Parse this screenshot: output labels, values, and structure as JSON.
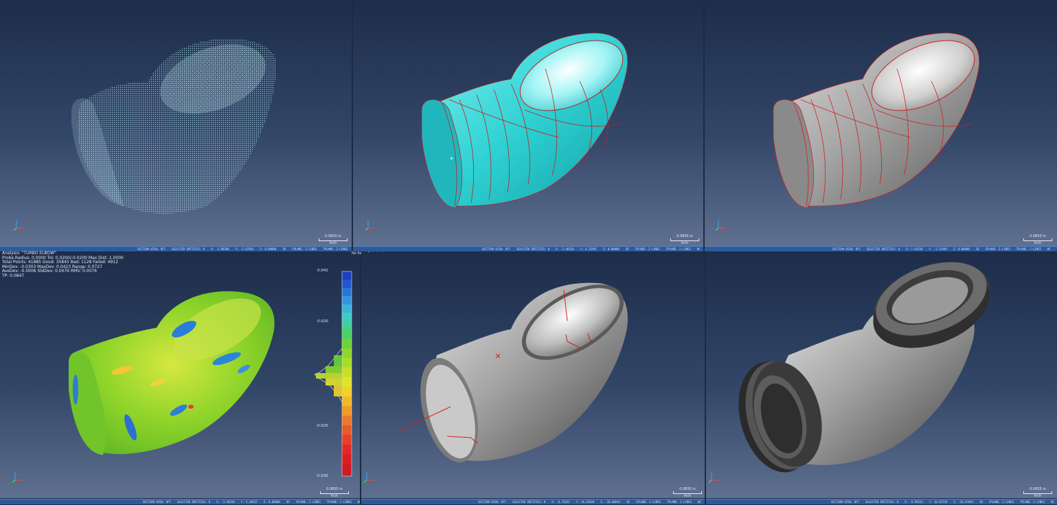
{
  "panels": {
    "p1": {
      "status": [
        "SECTION VIEW: OFF",
        "SELECTED ENTITIES: 0",
        "X: -3.96308",
        "Y: -3.42584",
        "Z: 0.80000",
        "3D",
        "CPLANE: 2-LINES",
        "TPLANE: 2-LINES",
        "WC"
      ],
      "scale": "0.0835 in",
      "unit": "Inch"
    },
    "p2": {
      "status": [
        "SECTION VIEW: OFF",
        "SELECTED ENTITIES: 0",
        "X: -3.48250",
        "Y: 4.23445",
        "Z: 0.80000",
        "3D",
        "CPLANE: 2-LINES",
        "TPLANE: 2-LINES",
        "WC"
      ],
      "scale": "0.0835 in",
      "unit": "Inch"
    },
    "p3": {
      "status": [
        "SECTION VIEW: OFF",
        "SELECTED ENTITIES: 0",
        "X: 7.44236",
        "Y: -1.12449",
        "Z: 0.00000",
        "3D",
        "CPLANE: 2-LINES",
        "TPLANE: 2-LINES",
        "WC"
      ],
      "scale": "0.0835 in",
      "unit": "Inch"
    },
    "p4": {
      "status": [
        "SECTION VIEW: OFF",
        "SELECTED ENTITIES: 0",
        "X: -3.50258",
        "Y: 5.39615",
        "Z: 0.00000",
        "3D",
        "CPLANE: 2-LINES",
        "TPLANE: 2-LINES",
        "WC"
      ],
      "scale": "0.0835 in",
      "unit": "Inch"
    },
    "p5": {
      "status": [
        "SECTION VIEW: OFF",
        "SELECTED ENTITIES: 0",
        "X: -6.75632",
        "Y: 14.26260",
        "Z: -26.60644",
        "3D",
        "CPLANE: 2-LINES",
        "TPLANE: 2-LINES",
        "WC"
      ],
      "scale": "0.0835 in",
      "unit": "Inch"
    },
    "p6": {
      "status": [
        "SECTION VIEW: OFF",
        "SELECTED ENTITIES: 0",
        "X: -9.95633",
        "Y: 10.65720",
        "Z: -26.67844",
        "3D",
        "CPLANE: 2-LINES",
        "TPLANE: 2-LINES",
        "WC"
      ],
      "scale": "0.0835 in",
      "unit": "Inch"
    }
  },
  "analysis": {
    "lines": [
      "Analysis: \"TURBO ELBOW\"",
      "Probe Radius: 0.0000 Tol: 0.0200/-0.0200 Max Dist: 1.0000",
      "Total Points: 41885 Good: 35845 Bad: 1128 Failed: 4912",
      "MinDev: -0.0303 MaxDev: 0.0423 Range: 0.0727",
      "AveDev: -0.0006 StdDev: 0.0076 RMS: 0.0076",
      "TP: 0.0847"
    ],
    "items_selected": "No Items Selected",
    "colorbar_ticks": [
      "0.042",
      "0.020",
      "-0.020",
      "-0.030"
    ]
  },
  "colors": {
    "cyan": "#35d6d8",
    "deviation_green": "#8ed62a",
    "bar_blue": "#2f5a9a"
  }
}
